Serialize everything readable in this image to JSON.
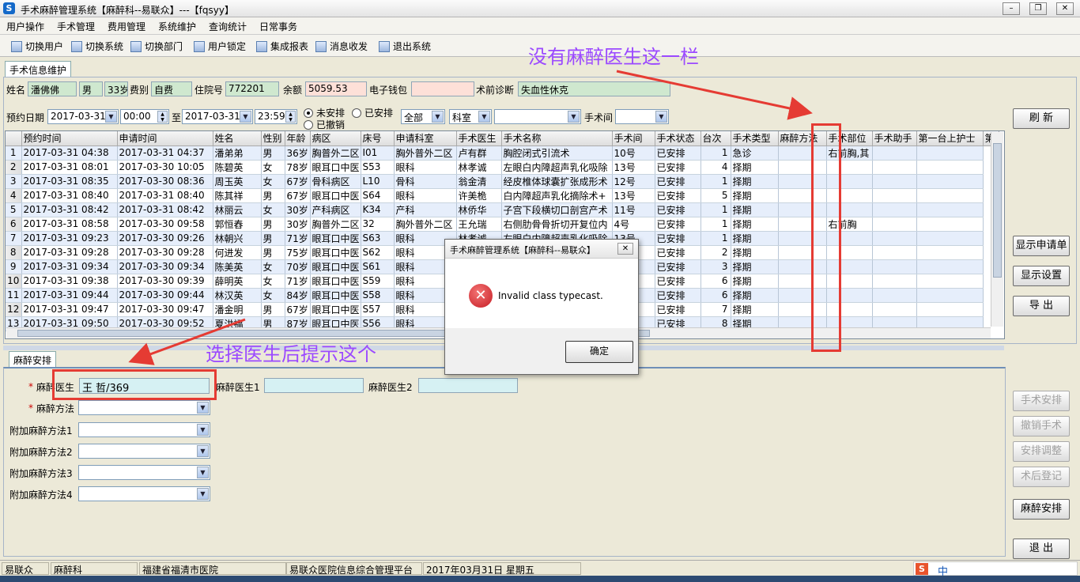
{
  "window": {
    "title": "手术麻醉管理系统【麻醉科--易联众】---【fqsyy】"
  },
  "menu": [
    "用户操作",
    "手术管理",
    "费用管理",
    "系统维护",
    "查询统计",
    "日常事务"
  ],
  "toolbar": [
    "切换用户",
    "切换系统",
    "切换部门",
    "用户锁定",
    "集成报表",
    "消息收发",
    "退出系统"
  ],
  "top_tab": "手术信息维护",
  "patient": {
    "name_label": "姓名",
    "name": "潘佛佛",
    "sex": "男",
    "age": "33岁",
    "fee_label": "费别",
    "fee": "自费",
    "inpatient_label": "住院号",
    "inpatient": "772201",
    "balance_label": "余额",
    "balance": "5059.53",
    "wallet_label": "电子钱包",
    "wallet": "",
    "diag_label": "术前诊断",
    "diag": "失血性休克"
  },
  "filter": {
    "date_label": "预约日期",
    "date_from": "2017-03-31",
    "time_from": "00:00",
    "to_label": "至",
    "date_to": "2017-03-31",
    "time_to": "23:59",
    "radio_unscheduled": "未安排",
    "radio_scheduled": "已安排",
    "radio_cancelled": "已撤销",
    "all": "全部",
    "dept": "科室",
    "dept_value": "",
    "room_label": "手术间",
    "room_value": ""
  },
  "grid": {
    "columns": [
      "预约时间",
      "申请时间",
      "姓名",
      "性别",
      "年龄",
      "病区",
      "床号",
      "申请科室",
      "手术医生",
      "手术名称",
      "手术间",
      "手术状态",
      "台次",
      "手术类型",
      "麻醉方法",
      "手术部位",
      "手术助手",
      "第一台上护士",
      "第"
    ],
    "rows": [
      [
        "1",
        "2017-03-31 04:38",
        "2017-03-31 04:37",
        "潘弟弟",
        "男",
        "36岁",
        "胸普外二区",
        "I01",
        "胸外普外二区",
        "卢有群",
        "胸腔闭式引流术",
        "10号",
        "已安排",
        "1",
        "急诊",
        "",
        "右前胸,其",
        "",
        ""
      ],
      [
        "2",
        "2017-03-31 08:01",
        "2017-03-30 10:05",
        "陈碧英",
        "女",
        "78岁",
        "眼耳口中医",
        "S53",
        "眼科",
        "林孝诚",
        "左眼白内障超声乳化吸除",
        "13号",
        "已安排",
        "4",
        "择期",
        "",
        "",
        "",
        ""
      ],
      [
        "3",
        "2017-03-31 08:35",
        "2017-03-30 08:36",
        "周玉英",
        "女",
        "67岁",
        "骨科病区",
        "L10",
        "骨科",
        "翁金清",
        "经皮椎体球囊扩张成形术",
        "12号",
        "已安排",
        "1",
        "择期",
        "",
        "",
        "",
        ""
      ],
      [
        "4",
        "2017-03-31 08:40",
        "2017-03-31 08:40",
        "陈其祥",
        "男",
        "67岁",
        "眼耳口中医",
        "S64",
        "眼科",
        "许美桅",
        "白内障超声乳化摘除术+",
        "13号",
        "已安排",
        "5",
        "择期",
        "",
        "",
        "",
        ""
      ],
      [
        "5",
        "2017-03-31 08:42",
        "2017-03-31 08:42",
        "林丽云",
        "女",
        "30岁",
        "产科病区",
        "K34",
        "产科",
        "林侨华",
        "子宫下段横切口剖宫产术",
        "11号",
        "已安排",
        "1",
        "择期",
        "",
        "",
        "",
        ""
      ],
      [
        "6",
        "2017-03-31 08:58",
        "2017-03-30 09:58",
        "郭恒舂",
        "男",
        "30岁",
        "胸普外二区",
        "32",
        "胸外普外二区",
        "王允瑞",
        "右侧肋骨骨折切开复位内",
        "4号",
        "已安排",
        "1",
        "择期",
        "",
        "右前胸",
        "",
        ""
      ],
      [
        "7",
        "2017-03-31 09:23",
        "2017-03-30 09:26",
        "林朝兴",
        "男",
        "71岁",
        "眼耳口中医",
        "S63",
        "眼科",
        "林孝诚",
        "左眼白内障超声乳化吸除",
        "13号",
        "已安排",
        "1",
        "择期",
        "",
        "",
        "",
        ""
      ],
      [
        "8",
        "2017-03-31 09:28",
        "2017-03-30 09:28",
        "何进发",
        "男",
        "75岁",
        "眼耳口中医",
        "S62",
        "眼科",
        "",
        "",
        "",
        "已安排",
        "2",
        "择期",
        "",
        "",
        "",
        ""
      ],
      [
        "9",
        "2017-03-31 09:34",
        "2017-03-30 09:34",
        "陈美英",
        "女",
        "70岁",
        "眼耳口中医",
        "S61",
        "眼科",
        "",
        "",
        "",
        "已安排",
        "3",
        "择期",
        "",
        "",
        "",
        ""
      ],
      [
        "10",
        "2017-03-31 09:38",
        "2017-03-30 09:39",
        "薛明英",
        "女",
        "71岁",
        "眼耳口中医",
        "S59",
        "眼科",
        "",
        "",
        "",
        "已安排",
        "6",
        "择期",
        "",
        "",
        "",
        ""
      ],
      [
        "11",
        "2017-03-31 09:44",
        "2017-03-30 09:44",
        "林汉英",
        "女",
        "84岁",
        "眼耳口中医",
        "S58",
        "眼科",
        "",
        "",
        "",
        "已安排",
        "6",
        "择期",
        "",
        "",
        "",
        ""
      ],
      [
        "12",
        "2017-03-31 09:47",
        "2017-03-30 09:47",
        "潘金明",
        "男",
        "67岁",
        "眼耳口中医",
        "S57",
        "眼科",
        "",
        "",
        "",
        "已安排",
        "7",
        "择期",
        "",
        "",
        "",
        ""
      ],
      [
        "13",
        "2017-03-31 09:50",
        "2017-03-30 09:52",
        "夏洪福",
        "男",
        "87岁",
        "眼耳口中医",
        "S56",
        "眼科",
        "",
        "",
        "",
        "已安排",
        "8",
        "择期",
        "",
        "",
        "",
        ""
      ]
    ]
  },
  "right_buttons": {
    "refresh": "刷  新",
    "show_request": "显示申请单",
    "show_settings": "显示设置",
    "export": "导  出",
    "op_schedule": "手术安排",
    "cancel_op": "撤销手术",
    "adjust": "安排调整",
    "post_reg": "术后登记",
    "anes_schedule": "麻醉安排",
    "exit": "退  出"
  },
  "anes": {
    "tab": "麻醉安排",
    "star": "*",
    "doctor_label": "麻醉医生",
    "doctor_value": "王  哲/369",
    "doctor1_label": "麻醉医生1",
    "doctor2_label": "麻醉医生2",
    "method_label": "麻醉方法",
    "extra1": "附加麻醉方法1",
    "extra2": "附加麻醉方法2",
    "extra3": "附加麻醉方法3",
    "extra4": "附加麻醉方法4"
  },
  "dialog": {
    "title": "手术麻醉管理系统【麻醉科--易联众】",
    "message": "Invalid class typecast.",
    "ok": "确定"
  },
  "annotations": {
    "top": "没有麻醉医生这一栏",
    "bottom": "选择医生后提示这个"
  },
  "status": [
    "易联众",
    "麻醉科",
    "福建省福清市医院",
    "易联众医院信息综合管理平台",
    "2017年03月31日 星期五"
  ],
  "ime": "中",
  "colors": {
    "annotation": "#9b49ff",
    "arrow": "#e53b33",
    "error": "#d0202c"
  }
}
